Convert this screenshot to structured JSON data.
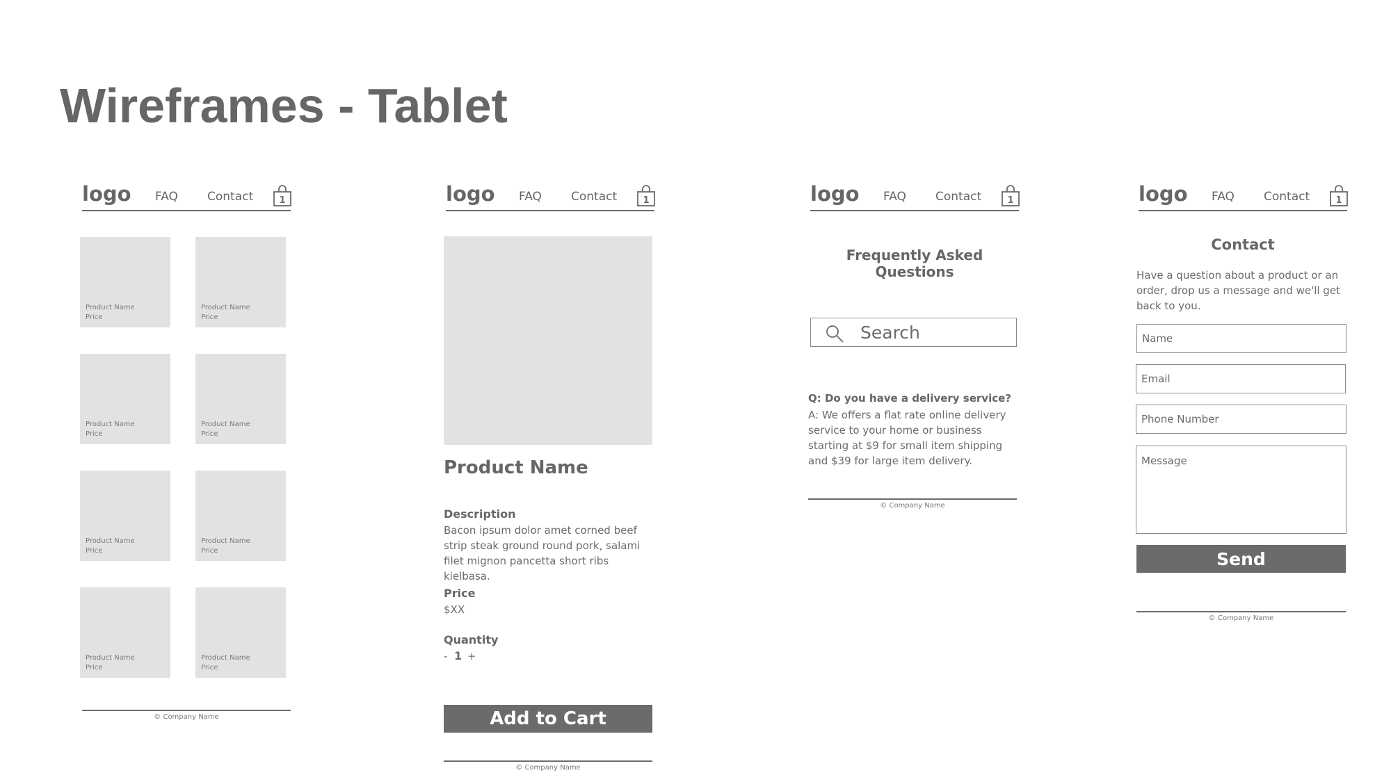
{
  "page": {
    "title": "Wireframes - Tablet"
  },
  "nav": {
    "logo": "logo",
    "faq": "FAQ",
    "contact": "Contact",
    "cart_count": "1"
  },
  "footer": {
    "text": "© Company Name"
  },
  "listing": {
    "products": [
      {
        "name": "Product Name",
        "price": "Price"
      },
      {
        "name": "Product Name",
        "price": "Price"
      },
      {
        "name": "Product Name",
        "price": "Price"
      },
      {
        "name": "Product Name",
        "price": "Price"
      },
      {
        "name": "Product Name",
        "price": "Price"
      },
      {
        "name": "Product Name",
        "price": "Price"
      },
      {
        "name": "Product Name",
        "price": "Price"
      },
      {
        "name": "Product Name",
        "price": "Price"
      }
    ]
  },
  "product": {
    "name": "Product Name",
    "description_label": "Description",
    "description_lines": [
      "Bacon ipsum dolor amet corned beef",
      "strip steak ground round pork, salami",
      "filet mignon pancetta short ribs kielbasa."
    ],
    "price_label": "Price",
    "price": "$XX",
    "quantity_label": "Quantity",
    "quantity_minus": "-",
    "quantity": "1",
    "quantity_plus": "+",
    "add_to_cart": "Add to Cart"
  },
  "faq": {
    "heading": "Frequently Asked Questions",
    "search_placeholder": "Search",
    "question": "Q: Do you have a delivery service?",
    "answer_lines": [
      "A: We offers a flat rate online delivery",
      "service to your home or business",
      "starting at $9 for small item shipping",
      "and $39 for large item delivery."
    ]
  },
  "contact": {
    "heading": "Contact",
    "intro_lines": [
      "Have a question about a product or an",
      "order, drop us a message and we'll get",
      "back to you."
    ],
    "name_placeholder": "Name",
    "email_placeholder": "Email",
    "phone_placeholder": "Phone Number",
    "message_placeholder": "Message",
    "send": "Send"
  },
  "colors": {
    "ink": "#6b6b6b",
    "placeholder_fill": "#e2e2e2",
    "background": "#ffffff"
  }
}
